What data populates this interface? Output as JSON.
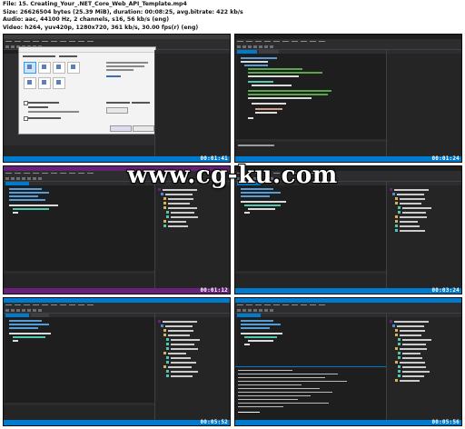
{
  "header": {
    "file_line": "File: 15. Creating_Your_.NET_Core_Web_API_Template.mp4",
    "size_line": "Size: 26626504 bytes (25.39 MiB), duration: 00:08:25, avg.bitrate: 422 kb/s",
    "audio_line": "Audio: aac, 44100 Hz, 2 channels, s16, 56 kb/s (eng)",
    "video_line": "Video: h264, yuv420p, 1280x720, 361 kb/s, 30.00 fps(r) (eng)"
  },
  "watermark": "www.cg-ku.com",
  "frames": [
    {
      "timestamp": "00:01:41",
      "titlebar_color": "#3c3c3c",
      "scene": "new-project-dialog"
    },
    {
      "timestamp": "00:01:24",
      "titlebar_color": "#1e1e1e",
      "scene": "code-editor"
    },
    {
      "timestamp": "00:01:12",
      "titlebar_color": "#68217a",
      "scene": "code-editor-with-explorer"
    },
    {
      "timestamp": "00:03:24",
      "titlebar_color": "#1e1e1e",
      "scene": "code-editor-with-explorer"
    },
    {
      "timestamp": "00:05:52",
      "titlebar_color": "#007acc",
      "scene": "code-editor-with-explorer"
    },
    {
      "timestamp": "00:05:56",
      "titlebar_color": "#007acc",
      "scene": "package-manager-output"
    }
  ],
  "colors": {
    "status_bar": "#007acc",
    "editor_bg": "#1e1e1e",
    "panel_bg": "#252526",
    "keyword": "#569cd6",
    "type": "#4ec9b0",
    "comment": "#57a64a",
    "string": "#d69d85",
    "plain": "#dcdcdc"
  }
}
